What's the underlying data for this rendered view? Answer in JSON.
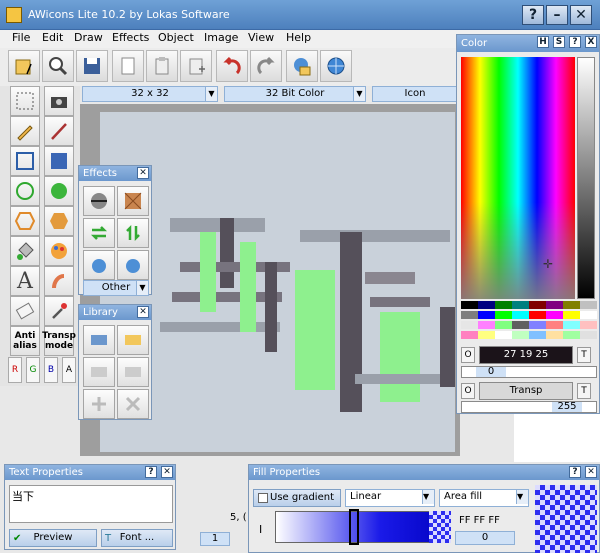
{
  "window": {
    "title": "AWicons Lite 10.2 by Lokas Software"
  },
  "menu": [
    "File",
    "Edit",
    "Draw",
    "Effects",
    "Object",
    "Image",
    "View",
    "Help"
  ],
  "toolbar_icons": [
    "open-icon",
    "zoom-icon",
    "save-icon",
    "copy-icon",
    "paste-icon",
    "paste-new-icon",
    "undo-icon",
    "redo-icon",
    "web-export-icon",
    "globe-icon"
  ],
  "combos": {
    "size": "32 x 32",
    "depth": "32 Bit Color",
    "icon": "Icon"
  },
  "tools": {
    "antialias": "Anti alias",
    "transp": "Transp mode",
    "channels": [
      "R",
      "G",
      "B",
      "A"
    ]
  },
  "effects_panel": {
    "title": "Effects",
    "other_label": "Other"
  },
  "library_panel": {
    "title": "Library"
  },
  "color_panel": {
    "title": "Color",
    "title_buttons": [
      "H",
      "S",
      "?",
      "X"
    ],
    "rgb_value": "27 19 25",
    "alpha_label": "O",
    "alpha_value": "0",
    "transp_label": "Transp",
    "transp_value": "255",
    "t_label": "T"
  },
  "text_panel": {
    "title": "Text Properties",
    "text": "当下",
    "preview_label": "Preview",
    "font_label": "Font ..."
  },
  "fill_panel": {
    "title": "Fill Properties",
    "use_gradient_label": "Use gradient",
    "gradient_type": "Linear",
    "fill_mode": "Area fill",
    "hex": "FF FF FF",
    "position_value": "0",
    "i_label": "I"
  },
  "status": {
    "coord": "5, (",
    "page_value": "1"
  },
  "colors": {
    "accent": "#6b97cd",
    "title_bar": "#4d80bd",
    "canvas_bg": "#c9d1da",
    "dark_pixel": "#55505a",
    "green_pixel": "#8ef08e",
    "gray_pixel": "#a4a8b0"
  }
}
